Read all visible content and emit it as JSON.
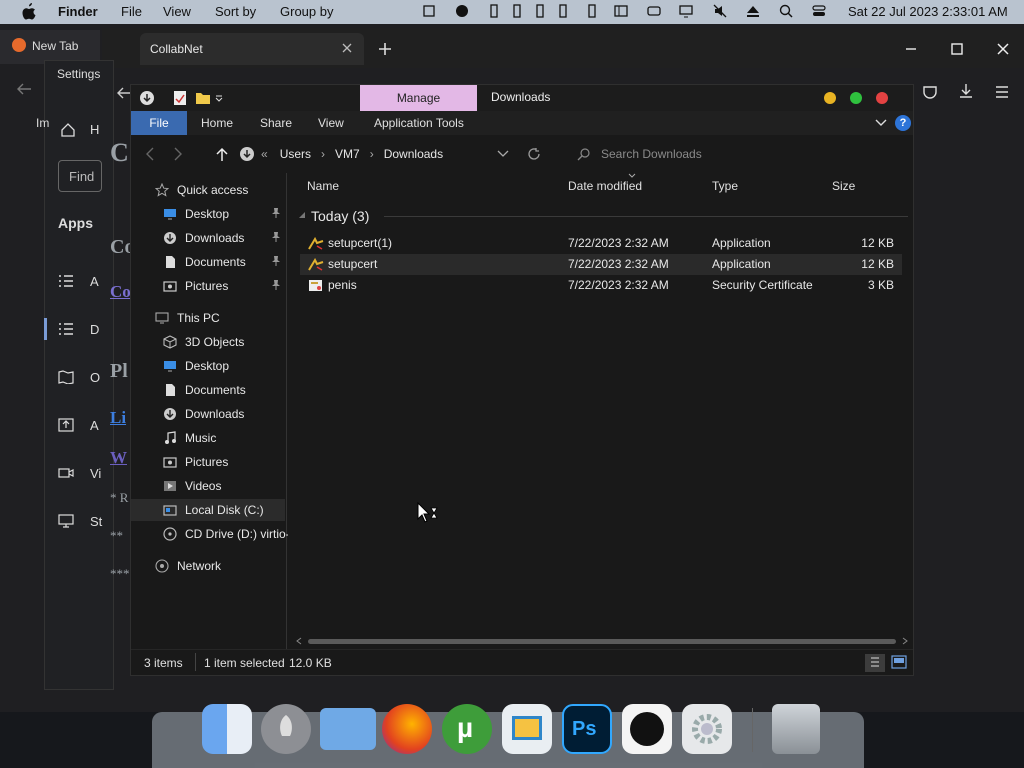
{
  "menubar": {
    "app": "Finder",
    "items": [
      "File",
      "View",
      "Sort by",
      "Group by"
    ],
    "clock": "Sat 22 Jul 2023  2:33:01 AM"
  },
  "background": {
    "settings_title": "Settings",
    "browser_tab": "New Tab",
    "edge_tab": "CollabNet",
    "apps_label": "Apps",
    "find_placeholder": "Find"
  },
  "explorer": {
    "manage_label": "Manage",
    "title": "Downloads",
    "ribbon": {
      "file": "File",
      "home": "Home",
      "share": "Share",
      "view": "View",
      "app_tools": "Application Tools"
    },
    "breadcrumb": [
      "Users",
      "VM7",
      "Downloads"
    ],
    "search_placeholder": "Search Downloads",
    "nav": {
      "quick_access": "Quick access",
      "quick": [
        {
          "label": "Desktop",
          "icon": "desktop-icon"
        },
        {
          "label": "Downloads",
          "icon": "downloads-icon"
        },
        {
          "label": "Documents",
          "icon": "documents-icon"
        },
        {
          "label": "Pictures",
          "icon": "pictures-icon"
        }
      ],
      "this_pc": "This PC",
      "pc": [
        {
          "label": "3D Objects",
          "icon": "cube-icon"
        },
        {
          "label": "Desktop",
          "icon": "desktop-icon"
        },
        {
          "label": "Documents",
          "icon": "documents-icon"
        },
        {
          "label": "Downloads",
          "icon": "downloads-icon"
        },
        {
          "label": "Music",
          "icon": "music-icon"
        },
        {
          "label": "Pictures",
          "icon": "pictures-icon"
        },
        {
          "label": "Videos",
          "icon": "videos-icon"
        },
        {
          "label": "Local Disk (C:)",
          "icon": "disk-icon"
        },
        {
          "label": "CD Drive (D:) virtio-",
          "icon": "cd-icon"
        }
      ],
      "network": "Network"
    },
    "columns": {
      "name": "Name",
      "date": "Date modified",
      "type": "Type",
      "size": "Size"
    },
    "group": "Today (3)",
    "rows": [
      {
        "name": "setupcert(1)",
        "date": "7/22/2023 2:32 AM",
        "type": "Application",
        "size": "12 KB"
      },
      {
        "name": "setupcert",
        "date": "7/22/2023 2:32 AM",
        "type": "Application",
        "size": "12 KB"
      },
      {
        "name": "penis",
        "date": "7/22/2023 2:32 AM",
        "type": "Security Certificate",
        "size": "3 KB"
      }
    ],
    "status": {
      "items": "3 items",
      "selected": "1 item selected",
      "size": "12.0 KB"
    }
  },
  "colors": {
    "manage": "#e3b8e6",
    "selected_row": "#2a2a2a",
    "accent": "#3a6ab0"
  }
}
